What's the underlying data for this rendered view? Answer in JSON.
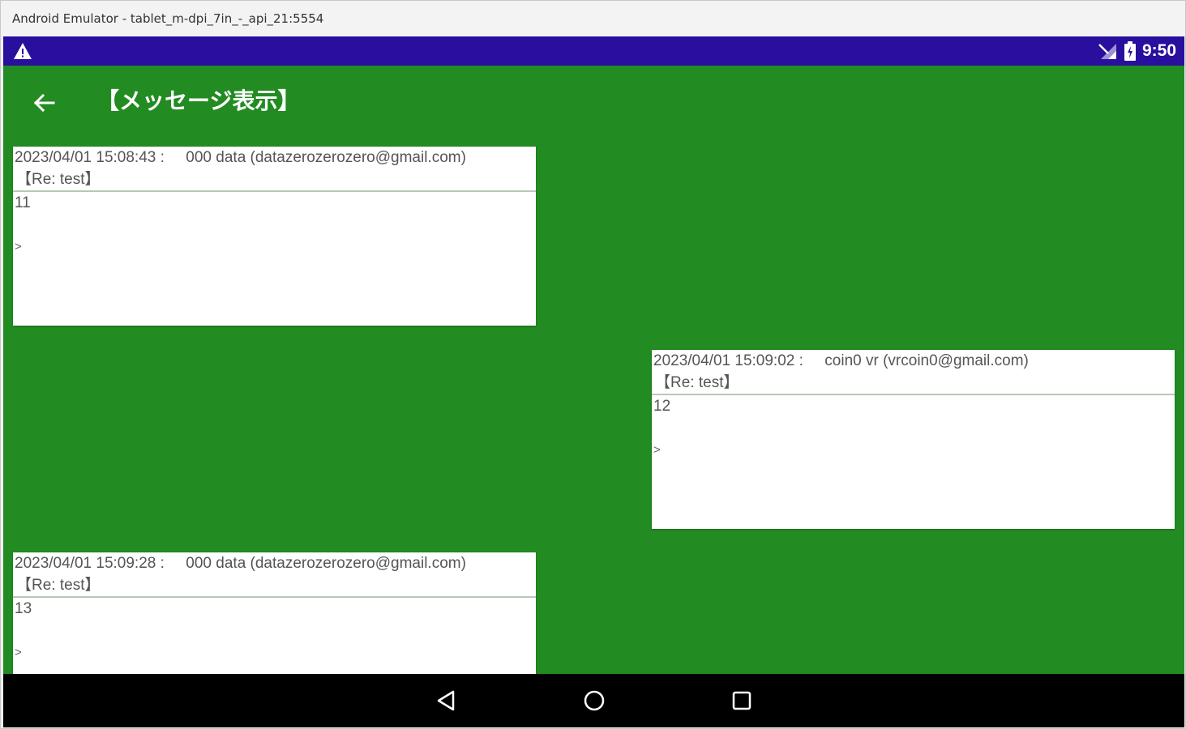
{
  "window": {
    "title": "Android Emulator - tablet_m-dpi_7in_-_api_21:5554"
  },
  "statusbar": {
    "time": "9:50",
    "icons": [
      "warning-icon",
      "signal-icon",
      "battery-icon"
    ],
    "color": "#2a0e9e"
  },
  "app": {
    "background": "#228b22",
    "title": "【メッセージ表示】",
    "back_icon": "arrow-left-icon"
  },
  "messages": [
    {
      "timestamp": "2023/04/01 15:08:43 :",
      "sender": "000 data (datazerozerozero@gmail.com)",
      "subject": "【Re: test】",
      "body": "11",
      "quote": ">",
      "align": "left"
    },
    {
      "timestamp": "2023/04/01 15:09:02 :",
      "sender": "coin0 vr (vrcoin0@gmail.com)",
      "subject": "【Re: test】",
      "body": "12",
      "quote": ">",
      "align": "right"
    },
    {
      "timestamp": "2023/04/01 15:09:28 :",
      "sender": "000 data (datazerozerozero@gmail.com)",
      "subject": "【Re: test】",
      "body": "13",
      "quote": ">",
      "align": "left"
    }
  ],
  "navbar": {
    "buttons": [
      "back-triangle-icon",
      "home-circle-icon",
      "recents-square-icon"
    ]
  }
}
